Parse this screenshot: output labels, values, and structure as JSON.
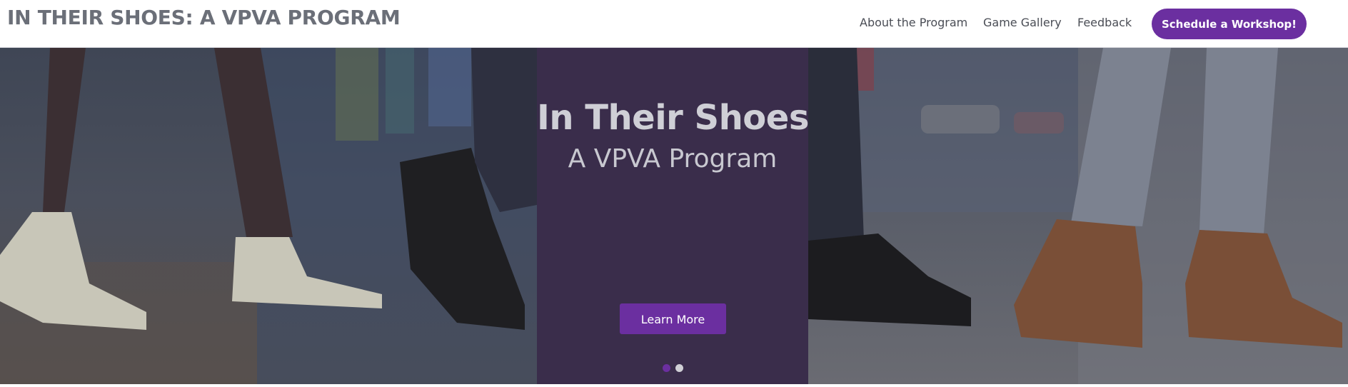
{
  "header": {
    "site_title": "IN THEIR SHOES: A VPVA PROGRAM",
    "nav": {
      "about": "About the Program",
      "gallery": "Game Gallery",
      "feedback": "Feedback"
    },
    "cta_label": "Schedule a Workshop!"
  },
  "hero": {
    "title": "In Their Shoes",
    "subtitle": "A VPVA Program",
    "learn_more_label": "Learn More",
    "active_slide": 1,
    "slide_count": 2
  },
  "colors": {
    "brand_purple": "#6b2fa0",
    "panel": "#3a2d4b",
    "title_gray": "#6b6f78"
  }
}
